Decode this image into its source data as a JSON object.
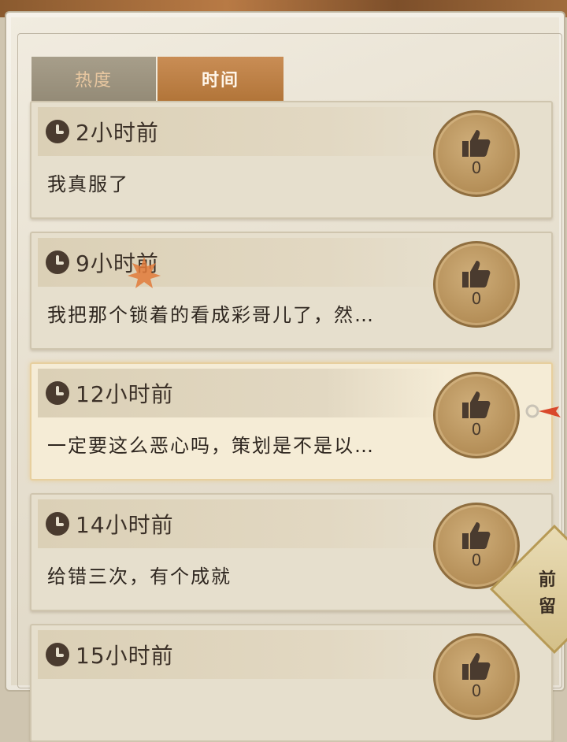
{
  "tabs": [
    {
      "label": "热度",
      "active": false
    },
    {
      "label": "时间",
      "active": true
    }
  ],
  "comments": [
    {
      "time": "2小时前",
      "text": "我真服了",
      "likes": "0"
    },
    {
      "time": "9小时前",
      "text": "我把那个锁着的看成彩哥儿了，然…",
      "likes": "0"
    },
    {
      "time": "12小时前",
      "text": "一定要这么恶心吗，策划是不是以…",
      "likes": "0"
    },
    {
      "time": "14小时前",
      "text": "给错三次，有个成就",
      "likes": "0"
    },
    {
      "time": "15小时前",
      "text": "",
      "likes": "0"
    }
  ],
  "side_badge": {
    "line1": "前",
    "line2": "留"
  },
  "icons": {
    "clock": "clock-icon",
    "like": "thumbs-up-icon"
  },
  "colors": {
    "active_tab": "#c98d55",
    "inactive_tab_text": "#e8c7a0",
    "like_coin": "#b48e57"
  }
}
